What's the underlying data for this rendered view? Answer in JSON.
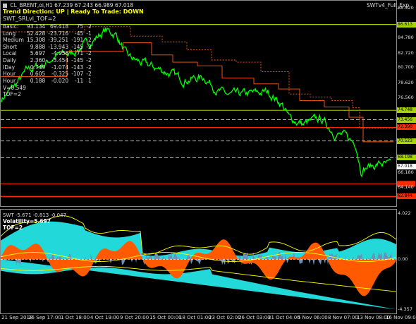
{
  "window": {
    "title": "CL_BRENT,oi,H1  67.239 67.243 66.989 67.018",
    "indicator_title": "SWTv4_Full_Exp",
    "trend_direction_label": "Trend Direction:",
    "trend_direction_value": "UP",
    "ready_to_trade_label": "Ready To Trade:",
    "ready_to_trade_value": "DOWN",
    "srlvl_label": "SWT_SRLvl_TOF=2"
  },
  "stats": [
    {
      "label": "Basic",
      "v1": "93.134",
      "v2": "69.418",
      "v3": "75",
      "v4": "2"
    },
    {
      "label": "Long",
      "v1": "52.428",
      "v2": "-23.716",
      "v3": "-45",
      "v4": "-1"
    },
    {
      "label": "Medium",
      "v1": "15.308",
      "v2": "-39.251",
      "v3": "-191",
      "v4": "-2"
    },
    {
      "label": "Short",
      "v1": "9.888",
      "v2": "-13.943",
      "v3": "-145",
      "v4": "-2"
    },
    {
      "label": "Local",
      "v1": "5.697",
      "v2": "-4.056",
      "v3": "-71",
      "v4": "-2"
    },
    {
      "label": "Daily",
      "v1": "2.360",
      "v2": "-3.454",
      "v3": "-145",
      "v4": "-2"
    },
    {
      "label": "IDay",
      "v1": "0.749",
      "v2": "-1.074",
      "v3": "-143",
      "v4": "-2"
    },
    {
      "label": "Hour",
      "v1": "0.605",
      "v2": "-0.325",
      "v3": "-107",
      "v4": "-2"
    },
    {
      "label": "Hour",
      "v1": "0.188",
      "v2": "-0.020",
      "v3": "-11",
      "v4": "1"
    }
  ],
  "v_label": "V=0.549",
  "tof_label_main": "TOF=2",
  "sub": {
    "title": "SWT -5.671 -0.813 -0.047",
    "volatility": "Volatility=5.697",
    "tof": "TOF=2",
    "y_labels": [
      "4.022",
      "0.00",
      "-4.357"
    ]
  },
  "price_axis": [
    "88.920",
    "86.613",
    "84.780",
    "82.720",
    "80.700",
    "78.620",
    "76.560",
    "74.748",
    "73.456",
    "72.390",
    "70.523",
    "68.198",
    "67.018",
    "66.180",
    "64.140",
    "62.844"
  ],
  "time_axis": [
    "21 Sep 2018",
    "26 Sep 17:00",
    "1 Oct 18:00",
    "4 Oct 19:00",
    "9 Oct 20:00",
    "15 Oct 00:00",
    "18 Oct 01:00",
    "23 Oct 02:00",
    "26 Oct 03:00",
    "31 Oct 04:00",
    "5 Nov 06:00",
    "8 Nov 07:00",
    "13 Nov 08:00",
    "16 Nov 09:00"
  ],
  "colors": {
    "price_line": "#00ff00",
    "level_green": "#a8d400",
    "level_red": "#ff2a00",
    "resistance": "#ff5a1a",
    "cyan": "#22d8d8",
    "orange": "#ff5a00",
    "yellow": "#ffff00",
    "steel": "#6f8fb8"
  }
}
